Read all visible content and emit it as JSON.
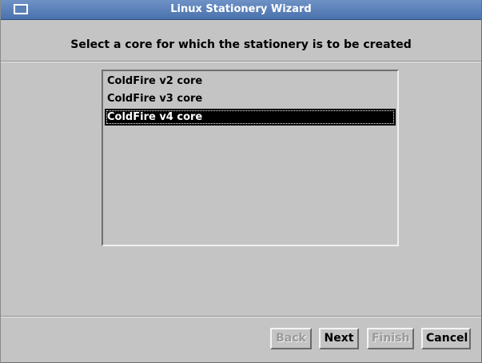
{
  "window": {
    "title": "Linux Stationery Wizard",
    "icon": "window-icon"
  },
  "heading": "Select a core for which the stationery is to be created",
  "cores": {
    "items": [
      {
        "label": "ColdFire v2 core",
        "selected": false
      },
      {
        "label": "ColdFire v3 core",
        "selected": false
      },
      {
        "label": "ColdFire v4 core",
        "selected": true
      }
    ]
  },
  "buttons": {
    "back": {
      "label": "Back",
      "enabled": false
    },
    "next": {
      "label": "Next",
      "enabled": true
    },
    "finish": {
      "label": "Finish",
      "enabled": false
    },
    "cancel": {
      "label": "Cancel",
      "enabled": true
    }
  },
  "colors": {
    "titlebar": "#4a72ad",
    "background": "#c4c4c4",
    "selection": "#000000"
  }
}
